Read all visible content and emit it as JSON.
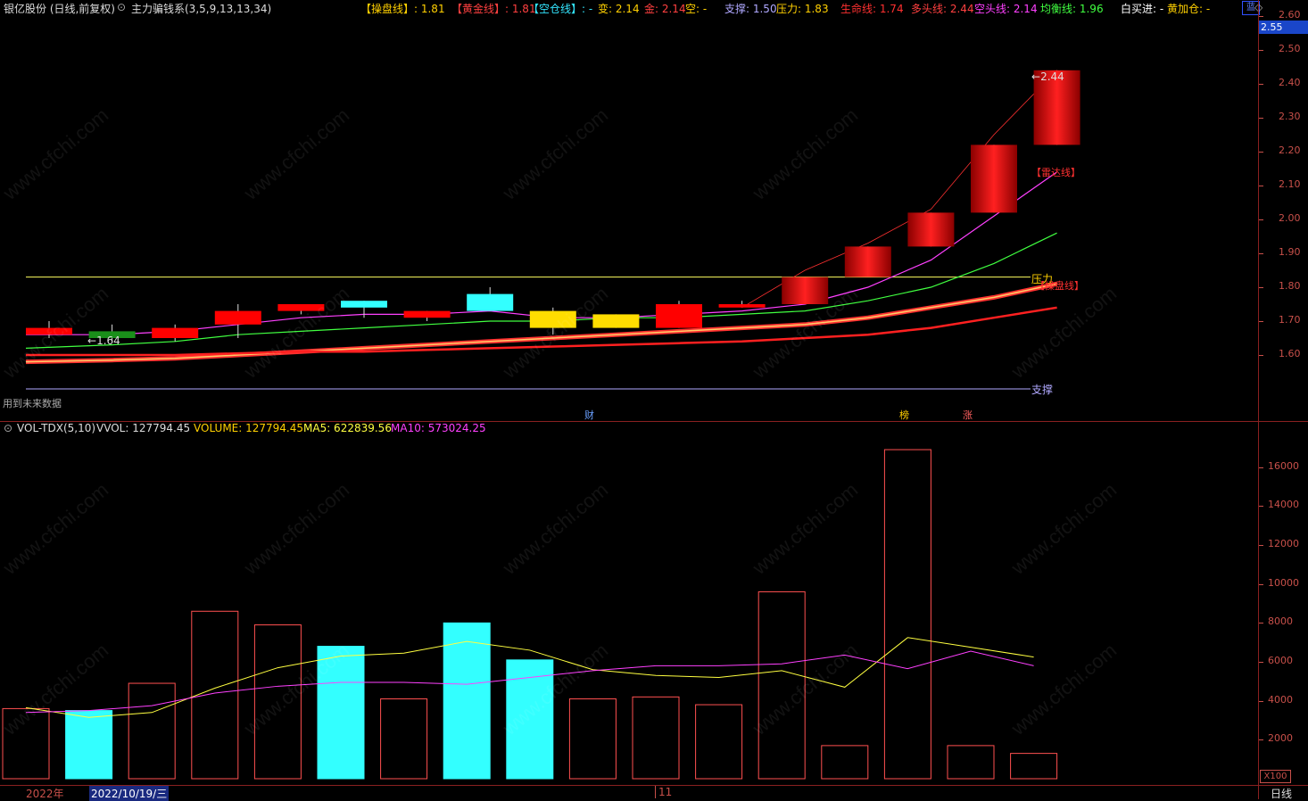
{
  "header": {
    "stock": "银亿股份 (日线,前复权)",
    "indicator": "主力骗钱系(3,5,9,13,13,34)",
    "items": [
      {
        "label": "【操盘线】: ",
        "value": "1.81",
        "color": "#ffd000"
      },
      {
        "label": "【黄金线】: ",
        "value": "1.81",
        "color": "#ff4040"
      },
      {
        "label": "【空仓线】: ",
        "value": "-",
        "color": "#33e6ff"
      },
      {
        "label": "变: ",
        "value": "2.14",
        "color": "#ffd000"
      },
      {
        "label": "金: ",
        "value": "2.14",
        "color": "#ff4040"
      },
      {
        "label": "空: ",
        "value": "-",
        "color": "#ffd000"
      },
      {
        "label": "支撑: ",
        "value": "1.50",
        "color": "#b0a8ff"
      },
      {
        "label": "压力: ",
        "value": "1.83",
        "color": "#ffd000"
      },
      {
        "label": "生命线: ",
        "value": "1.74",
        "color": "#ff3030"
      },
      {
        "label": "多头线: ",
        "value": "2.44",
        "color": "#ff4040"
      },
      {
        "label": "空头线: ",
        "value": "2.14",
        "color": "#ff40ff"
      },
      {
        "label": "均衡线: ",
        "value": "1.96",
        "color": "#40ff40"
      },
      {
        "label": "白买进: ",
        "value": "-",
        "color": "#ffffff"
      },
      {
        "label": "黄加仓: ",
        "value": "-",
        "color": "#ffd000"
      }
    ],
    "more": "蓝",
    "current_price": "2.55"
  },
  "main_axis": {
    "ticks": [
      "2.60",
      "2.55",
      "2.50",
      "2.40",
      "2.30",
      "2.20",
      "2.10",
      "2.00",
      "1.90",
      "1.80",
      "1.70",
      "1.60"
    ]
  },
  "annotations": {
    "future_data": "用到未来数据",
    "high_label": "2.44",
    "low_label": "1.64",
    "radar": "【雷达线】",
    "pressure": "压力",
    "operate": "【操盘线】",
    "support": "支撑",
    "markers": [
      "财",
      "榜",
      "涨"
    ]
  },
  "volume_panel": {
    "title": "VOL-TDX(5,10)",
    "vvol": "VVOL: 127794.45",
    "volume": "VOLUME: 127794.45",
    "ma5": "MA5: 622839.56",
    "ma10": "MA10: 573024.25",
    "ticks": [
      "16000",
      "14000",
      "12000",
      "10000",
      "8000",
      "6000",
      "4000",
      "2000"
    ],
    "unit": "X100"
  },
  "footer": {
    "year": "2022年",
    "date": "2022/10/19/三",
    "month": "11",
    "period": "日线"
  },
  "watermark": "www.cfchi.com",
  "chart_data": [
    {
      "type": "candlestick",
      "ylim": [
        1.5,
        2.6
      ],
      "candles": [
        {
          "o": 1.66,
          "c": 1.68,
          "h": 1.7,
          "l": 1.65,
          "color": "#ff0000"
        },
        {
          "o": 1.67,
          "c": 1.65,
          "h": 1.69,
          "l": 1.64,
          "color": "#1a8f1a"
        },
        {
          "o": 1.65,
          "c": 1.68,
          "h": 1.69,
          "l": 1.64,
          "color": "#ff0000"
        },
        {
          "o": 1.69,
          "c": 1.73,
          "h": 1.75,
          "l": 1.65,
          "color": "#ff0000"
        },
        {
          "o": 1.73,
          "c": 1.75,
          "h": 1.75,
          "l": 1.72,
          "color": "#ff0000"
        },
        {
          "o": 1.74,
          "c": 1.76,
          "h": 1.76,
          "l": 1.71,
          "color": "#33ffff"
        },
        {
          "o": 1.73,
          "c": 1.71,
          "h": 1.73,
          "l": 1.7,
          "color": "#ff0000"
        },
        {
          "o": 1.73,
          "c": 1.78,
          "h": 1.8,
          "l": 1.73,
          "color": "#33ffff"
        },
        {
          "o": 1.73,
          "c": 1.68,
          "h": 1.74,
          "l": 1.66,
          "color": "#ffdd00"
        },
        {
          "o": 1.68,
          "c": 1.72,
          "h": 1.72,
          "l": 1.68,
          "color": "#ffdd00"
        },
        {
          "o": 1.68,
          "c": 1.75,
          "h": 1.76,
          "l": 1.68,
          "color": "#ff0000"
        },
        {
          "o": 1.74,
          "c": 1.75,
          "h": 1.76,
          "l": 1.74,
          "color": "#ff0000"
        },
        {
          "o": 1.75,
          "c": 1.83,
          "h": 1.83,
          "l": 1.75,
          "color": "#ff0000"
        },
        {
          "o": 1.83,
          "c": 1.92,
          "h": 1.92,
          "l": 1.83,
          "color": "#ff0000"
        },
        {
          "o": 1.92,
          "c": 2.02,
          "h": 2.02,
          "l": 1.92,
          "color": "#ff0000"
        },
        {
          "o": 2.02,
          "c": 2.22,
          "h": 2.22,
          "l": 2.02,
          "color": "#ff0000"
        },
        {
          "o": 2.22,
          "c": 2.44,
          "h": 2.44,
          "l": 2.22,
          "color": "#ff0000"
        }
      ],
      "lines": [
        {
          "name": "空头线",
          "color": "#ff40ff",
          "values": [
            1.66,
            1.66,
            1.67,
            1.69,
            1.71,
            1.72,
            1.72,
            1.73,
            1.71,
            1.71,
            1.72,
            1.73,
            1.75,
            1.8,
            1.88,
            2.01,
            2.14
          ]
        },
        {
          "name": "均衡线",
          "color": "#40ff40",
          "values": [
            1.62,
            1.63,
            1.64,
            1.66,
            1.67,
            1.68,
            1.69,
            1.7,
            1.7,
            1.71,
            1.71,
            1.72,
            1.73,
            1.76,
            1.8,
            1.87,
            1.96
          ]
        },
        {
          "name": "操盘线",
          "color": "#ff8c1a",
          "values": [
            1.58,
            1.585,
            1.59,
            1.6,
            1.61,
            1.62,
            1.63,
            1.64,
            1.65,
            1.66,
            1.67,
            1.68,
            1.69,
            1.71,
            1.74,
            1.77,
            1.81
          ]
        },
        {
          "name": "生命线",
          "color": "#ff2020",
          "values": [
            1.6,
            1.6,
            1.6,
            1.605,
            1.61,
            1.61,
            1.615,
            1.62,
            1.625,
            1.63,
            1.635,
            1.64,
            1.65,
            1.66,
            1.68,
            1.71,
            1.74
          ]
        }
      ],
      "pressure": 1.83,
      "support": 1.5
    },
    {
      "type": "bar",
      "ylim": [
        0,
        17500
      ],
      "volumes": [
        3600,
        3500,
        4900,
        8600,
        7900,
        6800,
        4100,
        8000,
        6100,
        4100,
        4200,
        3800,
        9600,
        1700,
        16900,
        1700,
        1300
      ],
      "bar_types": [
        "up",
        "down",
        "up",
        "up",
        "up",
        "down",
        "up",
        "down",
        "down",
        "up",
        "up",
        "up",
        "up",
        "up",
        "up",
        "up",
        "up"
      ],
      "ma5": [
        3650,
        3150,
        3400,
        4650,
        5700,
        6300,
        6450,
        7050,
        6600,
        5600,
        5300,
        5200,
        5550,
        4700,
        7250,
        6750,
        6250
      ],
      "ma10": [
        3400,
        3500,
        3750,
        4400,
        4750,
        4950,
        4950,
        4850,
        5200,
        5550,
        5800,
        5800,
        5900,
        6350,
        5650,
        6550,
        5800
      ]
    }
  ]
}
